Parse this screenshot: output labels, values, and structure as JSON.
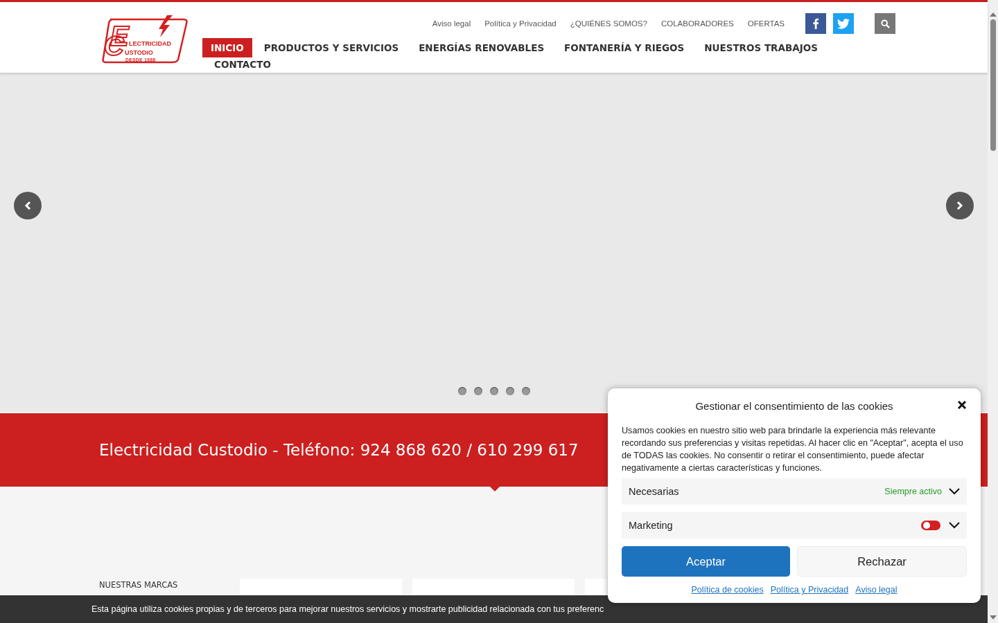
{
  "logo": {
    "initials": [
      "C",
      "E"
    ],
    "lines": [
      "LECTRICIDAD",
      "USTODIO"
    ],
    "since": "DESDE 1988"
  },
  "top_links": [
    "Aviso legal",
    "Política y Privacidad",
    "¿QUIÉNES SOMOS?",
    "COLABORADORES",
    "OFERTAS"
  ],
  "social": [
    {
      "kind": "facebook"
    },
    {
      "kind": "twitter"
    }
  ],
  "nav": [
    {
      "label": "INICIO",
      "selected": true
    },
    {
      "label": "PRODUCTOS Y SERVICIOS",
      "selected": false
    },
    {
      "label": "ENERGÍAS RENOVABLES",
      "selected": false
    },
    {
      "label": "FONTANERÍA Y RIEGOS",
      "selected": false
    },
    {
      "label": "NUESTROS TRABAJOS",
      "selected": false
    },
    {
      "label": "CONTACTO",
      "selected": false
    }
  ],
  "slider": {
    "dots": [
      {
        "selected": false
      },
      {
        "selected": false
      },
      {
        "selected": false
      },
      {
        "selected": false
      },
      {
        "selected": false
      }
    ]
  },
  "banner": {
    "text": "Electricidad Custodio - Teléfono: 924 868 620 / 610 299 617"
  },
  "brands": {
    "title": "NUESTRAS MARCAS"
  },
  "cookie_bar": {
    "text": "Esta página utiliza cookies propias y de terceros para mejorar nuestros servicios y mostrarte publicidad relacionada con tus preferenc"
  },
  "consent": {
    "title": "Gestionar el consentimiento de las cookies",
    "body": "Usamos cookies en nuestro sitio web para brindarle la experiencia más relevante recordando sus preferencias y visitas repetidas. Al hacer clic en \"Aceptar\", acepta el uso de TODAS las cookies. No consentir o retirar el consentimiento, puede afectar negativamente a ciertas características y funciones.",
    "categories": [
      {
        "kind": "always",
        "name": "Necesarias",
        "status": "Siempre activo"
      },
      {
        "kind": "toggle",
        "name": "Marketing",
        "on": false
      }
    ],
    "buttons": [
      {
        "label": "Aceptar",
        "kind": "primary"
      },
      {
        "label": "Rechazar",
        "kind": "secondary"
      }
    ],
    "links": [
      "Política de cookies",
      "Política y Privacidad",
      "Aviso legal"
    ]
  }
}
